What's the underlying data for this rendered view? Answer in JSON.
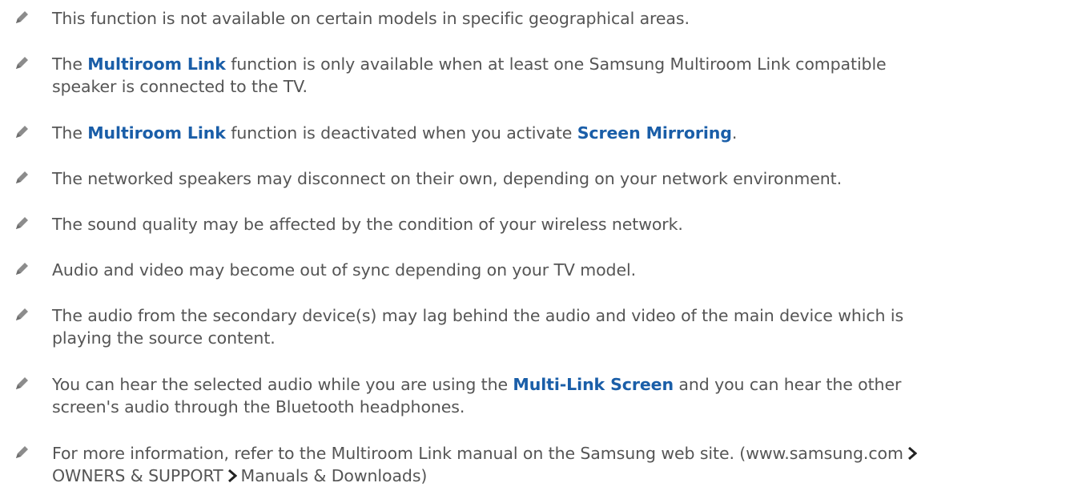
{
  "icons": {
    "note_icon": "pencil-icon",
    "path_separator": "chevron-right-icon"
  },
  "colors": {
    "text": "#555555",
    "highlight": "#1a5ea8",
    "icon": "#8c8c8c"
  },
  "notes": [
    {
      "line1": "This function is not available on certain models in specific geographical areas."
    },
    {
      "pre": "The ",
      "hl": "Multiroom Link",
      "post": " function is only available when at least one Samsung Multiroom Link compatible",
      "line2": "speaker is connected to the TV."
    },
    {
      "pre": "The ",
      "hl": "Multiroom Link",
      "mid": " function is deactivated when you activate ",
      "hl2": "Screen Mirroring",
      "post": "."
    },
    {
      "line1": "The networked speakers may disconnect on their own, depending on your network environment."
    },
    {
      "line1": "The sound quality may be affected by the condition of your wireless network."
    },
    {
      "line1": "Audio and video may become out of sync depending on your TV model."
    },
    {
      "line1": "The audio from the secondary device(s) may lag behind the audio and video of the main device which is",
      "line2": "playing the source content."
    },
    {
      "pre": "You can hear the selected audio while you are using the ",
      "hl": "Multi-Link Screen",
      "post": " and you can hear the other",
      "line2": "screen's audio through the Bluetooth headphones."
    },
    {
      "line1": "For more information, refer to the Multiroom Link manual on the Samsung web site. (www.samsung.com",
      "path1": "OWNERS & SUPPORT",
      "path2": "Manuals & Downloads)"
    }
  ]
}
